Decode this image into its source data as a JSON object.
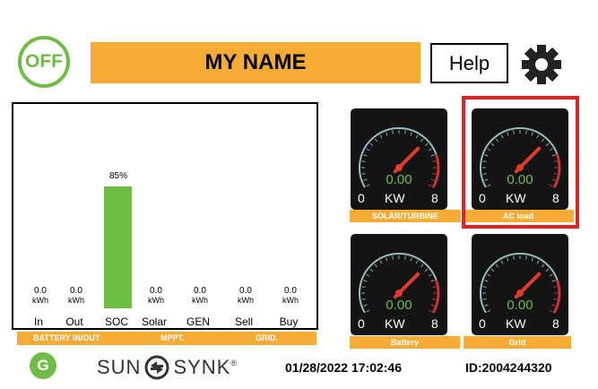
{
  "header": {
    "power_label": "OFF",
    "name": "MY NAME",
    "help_label": "Help"
  },
  "chart_data": {
    "type": "bar",
    "categories": [
      "In",
      "Out",
      "SOC",
      "Solar",
      "GEN",
      "Sell",
      "Buy"
    ],
    "values": [
      0.0,
      0.0,
      85,
      0.0,
      0.0,
      0.0,
      0.0
    ],
    "value_labels": [
      "0.0",
      "0.0",
      "85%",
      "0.0",
      "0.0",
      "0.0",
      "0.0"
    ],
    "units": [
      "kWh",
      "kWh",
      "",
      "kWh",
      "kWh",
      "kWh",
      "kWh"
    ],
    "ylim": [
      0,
      100
    ],
    "groups": [
      "BATTERY IN/OUT",
      "MPPT.",
      "GRID."
    ]
  },
  "gauges": [
    {
      "label": "SOLAR/TURBINE",
      "value": "0.00",
      "unit": "KW",
      "min": "0",
      "max": "8"
    },
    {
      "label": "AC load",
      "value": "0.00",
      "unit": "KW",
      "min": "0",
      "max": "8"
    },
    {
      "label": "Battery",
      "value": "0.00",
      "unit": "KW",
      "min": "0",
      "max": "8"
    },
    {
      "label": "Grid",
      "value": "0.00",
      "unit": "KW",
      "min": "0",
      "max": "8"
    }
  ],
  "footer": {
    "g_logo": "G",
    "brand_left": "SUN",
    "brand_right": "SYNK",
    "trademark": "®",
    "datetime": "01/28/2022  17:02:46",
    "device_id": "ID:2004244320"
  },
  "colors": {
    "accent": "#f6ac34",
    "green": "#6fbd45",
    "highlight": "#e02222",
    "gauge_bg": "#141414"
  }
}
